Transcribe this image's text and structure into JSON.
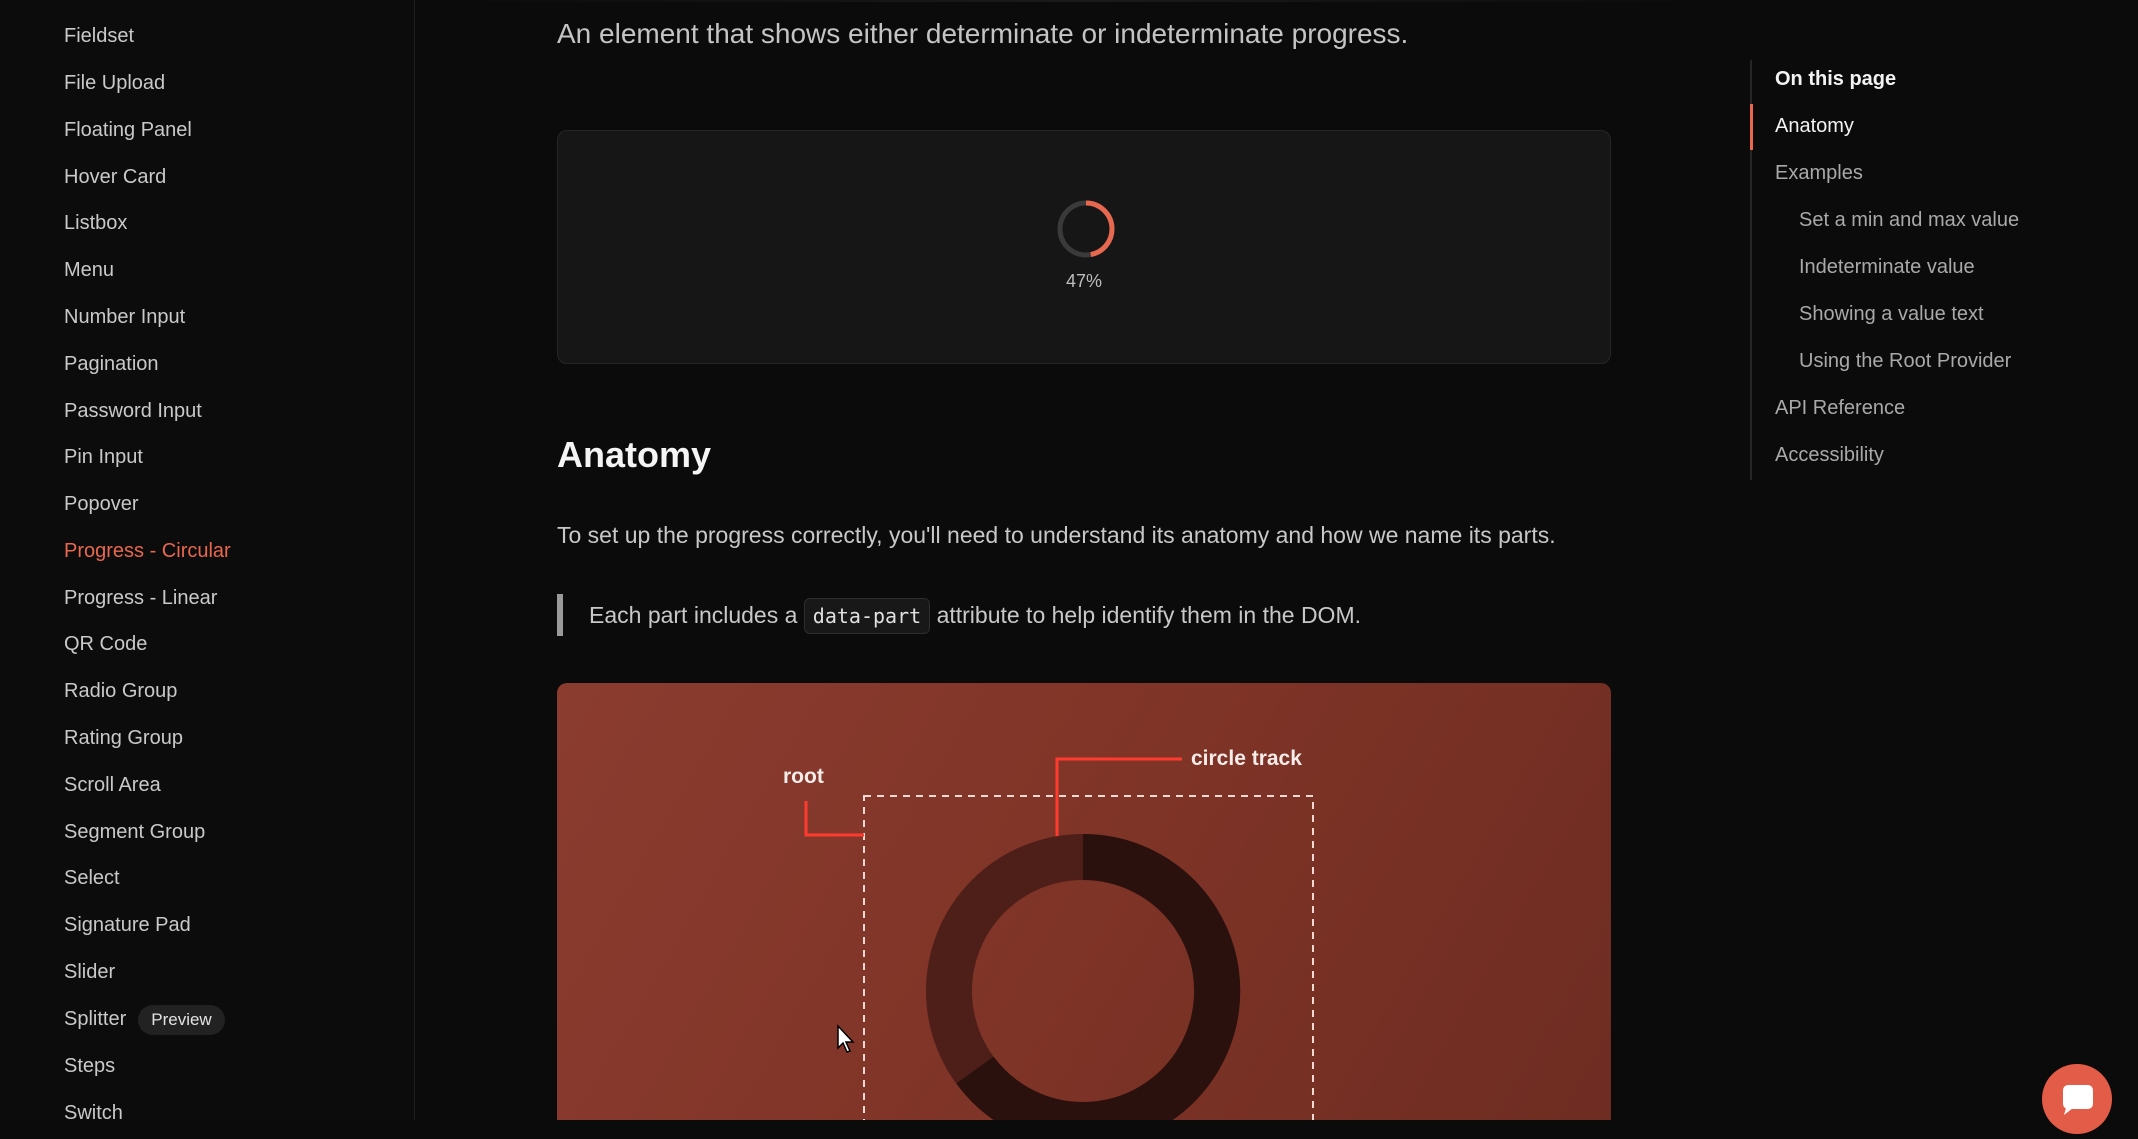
{
  "sidebar": {
    "items": [
      {
        "label": "Fieldset"
      },
      {
        "label": "File Upload"
      },
      {
        "label": "Floating Panel"
      },
      {
        "label": "Hover Card"
      },
      {
        "label": "Listbox"
      },
      {
        "label": "Menu"
      },
      {
        "label": "Number Input"
      },
      {
        "label": "Pagination"
      },
      {
        "label": "Password Input"
      },
      {
        "label": "Pin Input"
      },
      {
        "label": "Popover"
      },
      {
        "label": "Progress - Circular",
        "active": true
      },
      {
        "label": "Progress - Linear"
      },
      {
        "label": "QR Code"
      },
      {
        "label": "Radio Group"
      },
      {
        "label": "Rating Group"
      },
      {
        "label": "Scroll Area"
      },
      {
        "label": "Segment Group"
      },
      {
        "label": "Select"
      },
      {
        "label": "Signature Pad"
      },
      {
        "label": "Slider"
      },
      {
        "label": "Splitter",
        "badge": "Preview"
      },
      {
        "label": "Steps"
      },
      {
        "label": "Switch"
      }
    ]
  },
  "main": {
    "lead": "An element that shows either determinate or indeterminate progress.",
    "demo": {
      "value_text": "47%",
      "progress_fraction": 0.47
    },
    "section_title": "Anatomy",
    "paragraph": "To set up the progress correctly, you'll need to understand its anatomy and how we name its parts.",
    "callout": {
      "before": "Each part includes a",
      "code": "data-part",
      "after": "attribute to help identify them in the DOM."
    },
    "anatomy_labels": {
      "root": "root",
      "circle_track": "circle track"
    }
  },
  "toc": {
    "heading": "On this page",
    "items": [
      {
        "label": "Anatomy",
        "active": true
      },
      {
        "label": "Examples"
      },
      {
        "label": "Set a min and max value",
        "indent": true
      },
      {
        "label": "Indeterminate value",
        "indent": true
      },
      {
        "label": "Showing a value text",
        "indent": true
      },
      {
        "label": "Using the Root Provider",
        "indent": true
      },
      {
        "label": "API Reference"
      },
      {
        "label": "Accessibility"
      }
    ]
  },
  "colors": {
    "accent": "#e8674f",
    "background": "#0b0b0b",
    "anatomy_bg": "#823629",
    "chat": "#e25c47"
  },
  "icons": {
    "chat": "chat-bubble-icon",
    "cursor": "mouse-cursor-icon"
  }
}
